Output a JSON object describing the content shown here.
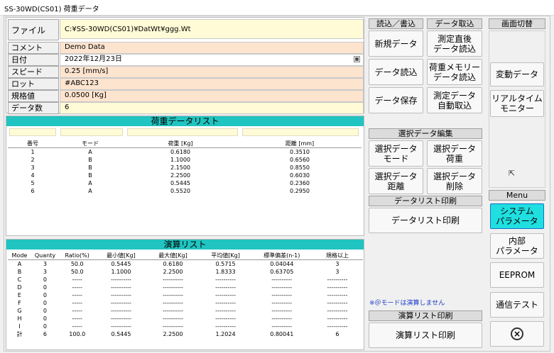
{
  "window": {
    "title": "SS-30WD(CS01) 荷重データ"
  },
  "info": {
    "file": {
      "label": "ファイル",
      "value": "C:¥SS-30WD(CS01)¥DatWt¥ggg.Wt"
    },
    "comment": {
      "label": "コメント",
      "value": "Demo Data"
    },
    "date": {
      "label": "日付",
      "value": "2022年12月23日"
    },
    "speed": {
      "label": "スピード",
      "value": "0.25 [mm/s]"
    },
    "lot": {
      "label": "ロット",
      "value": "#ABC123"
    },
    "spec": {
      "label": "規格値",
      "value": "0.0500 [Kg]"
    },
    "count": {
      "label": "データ数",
      "value": "6"
    }
  },
  "readwrite": {
    "header": "読込／書込",
    "new": "新規データ",
    "read": "データ読込",
    "save": "データ保存"
  },
  "capture": {
    "header": "データ取込",
    "after_measure": [
      "測定直後",
      "データ読込"
    ],
    "memory": [
      "荷重メモリー",
      "データ読込"
    ],
    "auto": [
      "測定データ",
      "自動取込"
    ]
  },
  "load_list": {
    "title": "荷重データリスト",
    "columns": [
      "番号",
      "モード",
      "荷重 [Kg]",
      "距離 [mm]"
    ],
    "rows": [
      [
        "1",
        "A",
        "0.6180",
        "0.3510"
      ],
      [
        "2",
        "B",
        "1.1000",
        "0.6560"
      ],
      [
        "3",
        "B",
        "2.1500",
        "0.8550"
      ],
      [
        "4",
        "B",
        "2.2500",
        "0.6030"
      ],
      [
        "5",
        "A",
        "0.5445",
        "0.2360"
      ],
      [
        "6",
        "A",
        "0.5520",
        "0.2950"
      ]
    ]
  },
  "edit": {
    "header": "選択データ編集",
    "mode": [
      "選択データ",
      "モード"
    ],
    "load": [
      "選択データ",
      "荷重"
    ],
    "dist": [
      "選択データ",
      "距離"
    ],
    "delete": [
      "選択データ",
      "削除"
    ]
  },
  "list_print": {
    "header": "データリスト印刷",
    "button": "データリスト印刷"
  },
  "calc_list": {
    "title": "演算リスト",
    "columns": [
      "Mode",
      "Quanty",
      "Ratio(%)",
      "最小値[Kg]",
      "最大値[Kg]",
      "平均値[Kg]",
      "標準偏差(n-1)",
      "規格以上"
    ],
    "rows": [
      [
        "A",
        "3",
        "50.0",
        "0.5445",
        "0.6180",
        "0.5715",
        "0.04044",
        "3"
      ],
      [
        "B",
        "3",
        "50.0",
        "1.1000",
        "2.2500",
        "1.8333",
        "0.63705",
        "3"
      ],
      [
        "C",
        "0",
        "-----",
        "----------",
        "----------",
        "----------",
        "----------",
        "----------"
      ],
      [
        "D",
        "0",
        "-----",
        "----------",
        "----------",
        "----------",
        "----------",
        "----------"
      ],
      [
        "E",
        "0",
        "-----",
        "----------",
        "----------",
        "----------",
        "----------",
        "----------"
      ],
      [
        "F",
        "0",
        "-----",
        "----------",
        "----------",
        "----------",
        "----------",
        "----------"
      ],
      [
        "G",
        "0",
        "-----",
        "----------",
        "----------",
        "----------",
        "----------",
        "----------"
      ],
      [
        "H",
        "0",
        "-----",
        "----------",
        "----------",
        "----------",
        "----------",
        "----------"
      ],
      [
        "I",
        "0",
        "-----",
        "----------",
        "----------",
        "----------",
        "----------",
        "----------"
      ],
      [
        "計",
        "6",
        "100.0",
        "0.5445",
        "2.2500",
        "1.2024",
        "0.80041",
        "6"
      ]
    ]
  },
  "note": "※＠モードは演算しません",
  "calc_print": {
    "header": "演算リスト印刷",
    "button": "演算リスト印刷"
  },
  "screen": {
    "header": "画面切替",
    "change_data": "変動データ",
    "realtime": [
      "リアルタイム",
      "モニター"
    ]
  },
  "menu": {
    "header": "Menu",
    "system": [
      "システム",
      "パラメータ"
    ],
    "internal": [
      "内部",
      "パラメータ"
    ],
    "eeprom": "EEPROM",
    "comm": "通信テスト"
  },
  "colors": {
    "accent_teal": "#20c4c0",
    "system_button": "#20dfe0",
    "note_blue": "#1a3cc8"
  }
}
